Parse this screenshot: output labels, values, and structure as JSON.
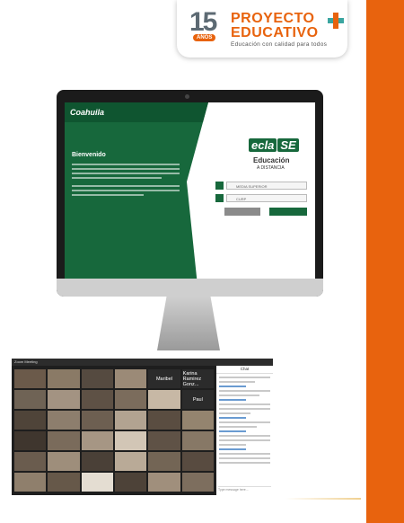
{
  "colors": {
    "orange": "#e8630e",
    "green": "#17683c",
    "teal": "#3aa5a0"
  },
  "logo": {
    "years": "15",
    "anos": "AÑOS",
    "title_line1": "PROYECTO",
    "title_line2": "EDUCATIVO",
    "tagline": "Educación con calidad para todos"
  },
  "monitor_screen": {
    "brand": "Coahuila",
    "welcome": "Bienvenido",
    "eclase": "ecla",
    "eclase_se": "SE",
    "education": "Educación",
    "distance": "A DISTANCIA",
    "level_field": "MEDIA SUPERIOR",
    "user_field": "CURP"
  },
  "zoom": {
    "window_title": "Zoom Meeting",
    "chat_title": "Chat",
    "participants": [
      {
        "name": "Maribel"
      },
      {
        "name": "Karina Ramirez Gonz..."
      },
      {
        "name": "Paul"
      }
    ],
    "chat_placeholder": "Type message here..."
  }
}
